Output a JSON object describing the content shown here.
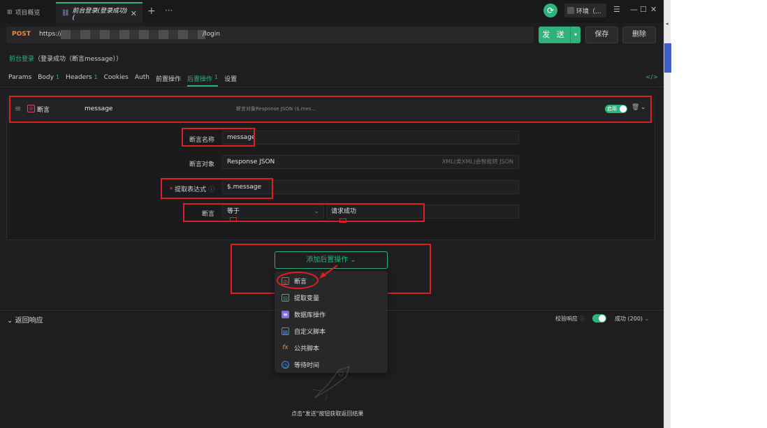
{
  "topbar": {
    "tab_overview": "项目概览",
    "tab_active": "前台登录(登录成功) (",
    "env_label": "环境（...",
    "plus": "+",
    "more": "···"
  },
  "request": {
    "method": "POST",
    "url_prefix": "https://",
    "url_suffix": "/login",
    "send_label": "发 送",
    "save_label": "保存",
    "delete_label": "删除"
  },
  "breadcrumb": {
    "name": "前台登录",
    "rest": "（登录成功（断言message））"
  },
  "tabs": [
    {
      "label": "Params",
      "badge": ""
    },
    {
      "label": "Body",
      "badge": "1"
    },
    {
      "label": "Headers",
      "badge": "1"
    },
    {
      "label": "Cookies",
      "badge": ""
    },
    {
      "label": "Auth",
      "badge": ""
    },
    {
      "label": "前置操作",
      "badge": ""
    },
    {
      "label": "后置操作",
      "badge": "1"
    },
    {
      "label": "设置",
      "badge": ""
    }
  ],
  "code_icon": "</>",
  "assertion": {
    "type_label": "断言",
    "name": "message",
    "target_summary": "断言对象Response JSON ($.mes...",
    "enabled_label": "启用",
    "fields": {
      "name_label": "断言名称",
      "name_value": "message",
      "target_label": "断言对象",
      "target_value": "Response JSON",
      "target_hint": "XML(类XML)会智能转 JSON",
      "extract_label": "提取表达式",
      "extract_required": "*",
      "extract_value": "$.message",
      "assert_label": "断言",
      "operator_value": "等于",
      "expected_value": "请求成功"
    }
  },
  "add_post_action": {
    "label": "添加后置操作",
    "menu": [
      {
        "label": "断言",
        "icon": "assertion-icon"
      },
      {
        "label": "提取变量",
        "icon": "extract-variable-icon"
      },
      {
        "label": "数据库操作",
        "icon": "database-icon"
      },
      {
        "label": "自定义脚本",
        "icon": "script-icon"
      },
      {
        "label": "公共脚本",
        "icon": "fx-icon"
      },
      {
        "label": "等待时间",
        "icon": "clock-icon"
      }
    ]
  },
  "response": {
    "title": "返回响应",
    "verify_label": "校验响应",
    "status": "成功 (200)",
    "hint": "点击\"发送\"按钮获取返回结果"
  },
  "colors": {
    "accent": "#2fb27c",
    "annotation_red": "#e02020",
    "method_orange": "#f0883e"
  }
}
